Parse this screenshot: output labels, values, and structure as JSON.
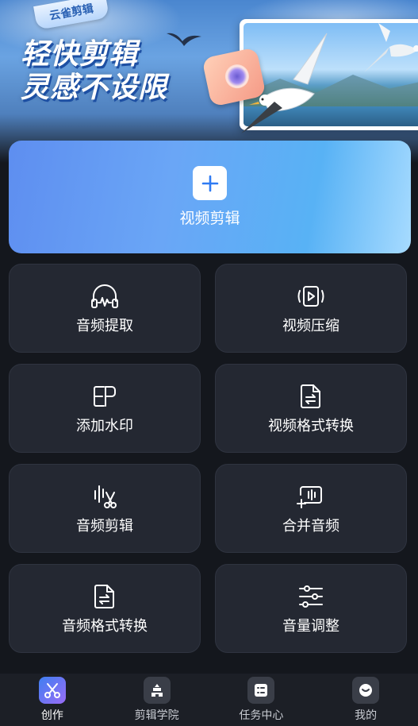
{
  "banner": {
    "badge": "云雀剪辑",
    "headline_line1": "轻快剪辑",
    "headline_line2": "灵感不设限"
  },
  "hero": {
    "icon": "plus-icon",
    "label": "视频剪辑"
  },
  "tools": [
    {
      "label": "音频提取",
      "icon": "headphones-wave-icon"
    },
    {
      "label": "视频压缩",
      "icon": "video-compress-icon"
    },
    {
      "label": "添加水印",
      "icon": "watermark-icon"
    },
    {
      "label": "视频格式转换",
      "icon": "file-convert-icon"
    },
    {
      "label": "音频剪辑",
      "icon": "audio-scissors-icon"
    },
    {
      "label": "合并音频",
      "icon": "merge-audio-icon"
    },
    {
      "label": "音频格式转换",
      "icon": "file-convert-icon"
    },
    {
      "label": "音量调整",
      "icon": "sliders-icon"
    }
  ],
  "nav": [
    {
      "label": "创作",
      "icon": "scissors-icon",
      "active": true
    },
    {
      "label": "剪辑学院",
      "icon": "academy-icon",
      "active": false
    },
    {
      "label": "任务中心",
      "icon": "task-list-icon",
      "active": false
    },
    {
      "label": "我的",
      "icon": "profile-icon",
      "active": false
    }
  ],
  "colors": {
    "background": "#14171d",
    "tile": "#242832",
    "hero_gradient_start": "#5e8ef0",
    "hero_gradient_end": "#a7dbff",
    "nav_active": "#3e7ff1"
  }
}
